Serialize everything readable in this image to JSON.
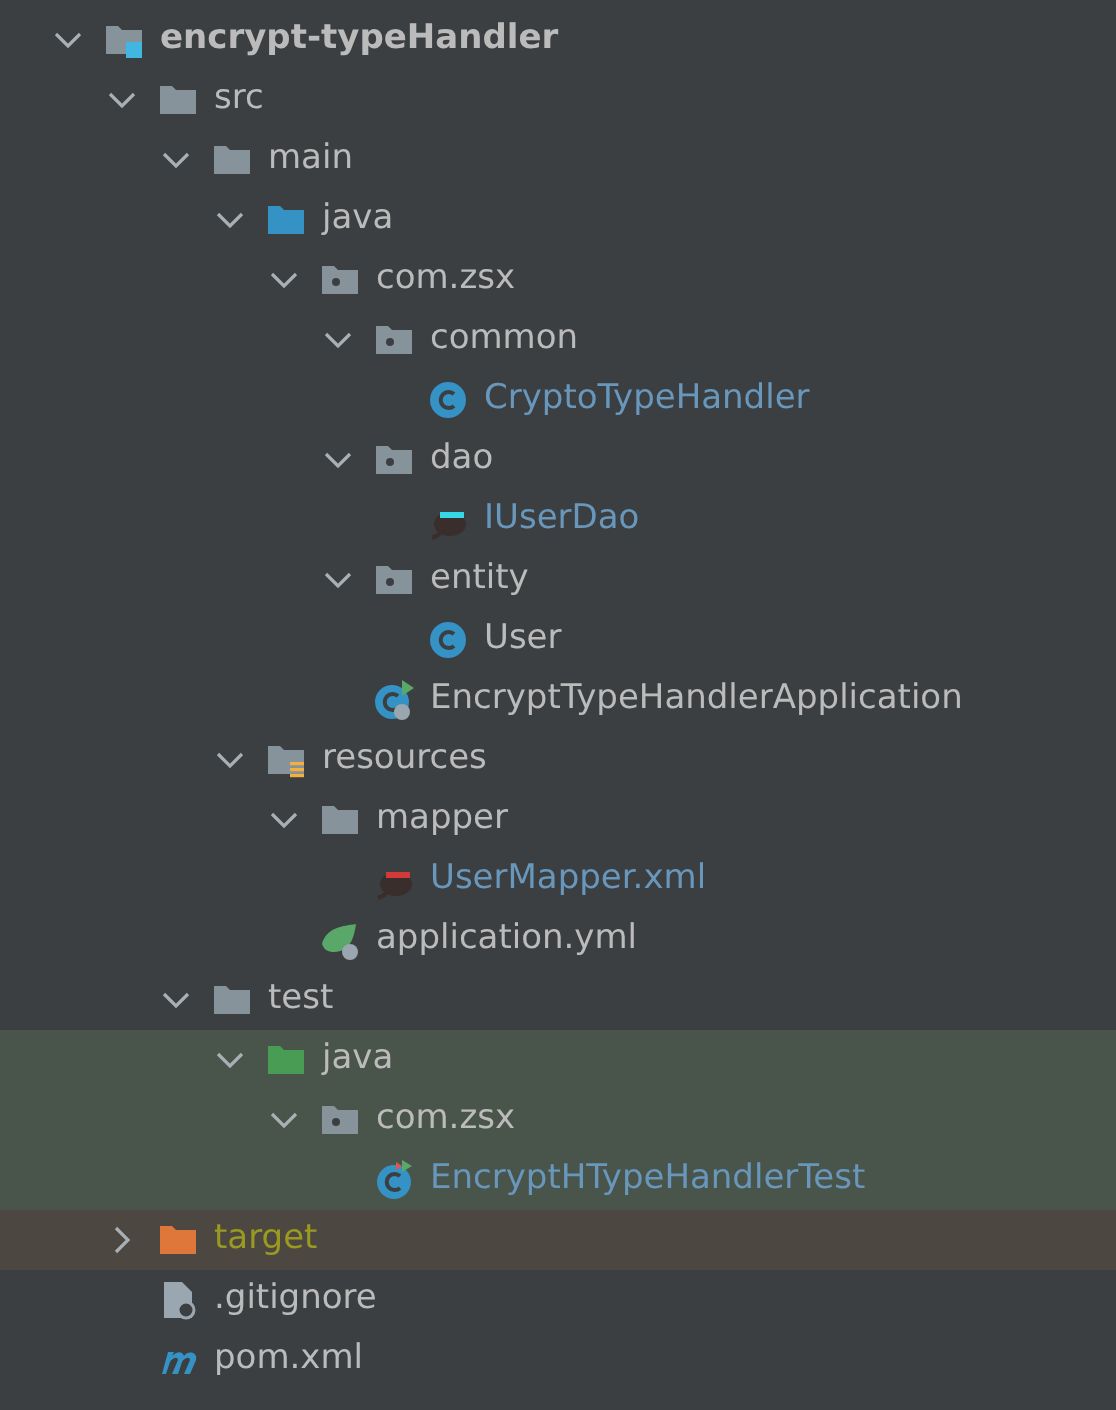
{
  "project_tree": [
    {
      "label": "encrypt-typeHandler",
      "kind": "module",
      "expanded": true,
      "modified": false,
      "ignored": false,
      "test": false,
      "excluded": false,
      "children": [
        {
          "label": "src",
          "kind": "folder",
          "expanded": true,
          "modified": false,
          "ignored": false,
          "test": false,
          "excluded": false,
          "children": [
            {
              "label": "main",
              "kind": "folder",
              "expanded": true,
              "modified": false,
              "ignored": false,
              "test": false,
              "excluded": false,
              "children": [
                {
                  "label": "java",
                  "kind": "source",
                  "expanded": true,
                  "modified": false,
                  "ignored": false,
                  "test": false,
                  "excluded": false,
                  "children": [
                    {
                      "label": "com.zsx",
                      "kind": "package",
                      "expanded": true,
                      "modified": false,
                      "ignored": false,
                      "test": false,
                      "excluded": false,
                      "children": [
                        {
                          "label": "common",
                          "kind": "package",
                          "expanded": true,
                          "modified": false,
                          "ignored": false,
                          "test": false,
                          "excluded": false,
                          "children": [
                            {
                              "label": "CryptoTypeHandler",
                              "kind": "class",
                              "modified": true,
                              "ignored": false,
                              "test": false,
                              "excluded": false
                            }
                          ]
                        },
                        {
                          "label": "dao",
                          "kind": "package",
                          "expanded": true,
                          "modified": false,
                          "ignored": false,
                          "test": false,
                          "excluded": false,
                          "children": [
                            {
                              "label": "IUserDao",
                              "kind": "mapper",
                              "modified": true,
                              "ignored": false,
                              "test": false,
                              "excluded": false
                            }
                          ]
                        },
                        {
                          "label": "entity",
                          "kind": "package",
                          "expanded": true,
                          "modified": false,
                          "ignored": false,
                          "test": false,
                          "excluded": false,
                          "children": [
                            {
                              "label": "User",
                              "kind": "class",
                              "modified": false,
                              "ignored": false,
                              "test": false,
                              "excluded": false
                            }
                          ]
                        },
                        {
                          "label": "EncryptTypeHandlerApplication",
                          "kind": "spring-class",
                          "modified": false,
                          "ignored": false,
                          "test": false,
                          "excluded": false
                        }
                      ]
                    }
                  ]
                },
                {
                  "label": "resources",
                  "kind": "resources",
                  "expanded": true,
                  "modified": false,
                  "ignored": false,
                  "test": false,
                  "excluded": false,
                  "children": [
                    {
                      "label": "mapper",
                      "kind": "folder",
                      "expanded": true,
                      "modified": false,
                      "ignored": false,
                      "test": false,
                      "excluded": false,
                      "children": [
                        {
                          "label": "UserMapper.xml",
                          "kind": "mapper-xml",
                          "modified": true,
                          "ignored": false,
                          "test": false,
                          "excluded": false
                        }
                      ]
                    },
                    {
                      "label": "application.yml",
                      "kind": "spring-yml",
                      "modified": false,
                      "ignored": false,
                      "test": false,
                      "excluded": false
                    }
                  ]
                }
              ]
            },
            {
              "label": "test",
              "kind": "folder",
              "expanded": true,
              "modified": false,
              "ignored": false,
              "test": false,
              "excluded": false,
              "children": [
                {
                  "label": "java",
                  "kind": "test-source",
                  "expanded": true,
                  "modified": false,
                  "ignored": false,
                  "test": true,
                  "excluded": false,
                  "children": [
                    {
                      "label": "com.zsx",
                      "kind": "package",
                      "expanded": true,
                      "modified": false,
                      "ignored": false,
                      "test": true,
                      "excluded": false,
                      "children": [
                        {
                          "label": "EncryptHTypeHandlerTest",
                          "kind": "test-class",
                          "modified": true,
                          "ignored": false,
                          "test": true,
                          "excluded": false
                        }
                      ]
                    }
                  ]
                }
              ]
            }
          ]
        },
        {
          "label": "target",
          "kind": "excluded",
          "expanded": false,
          "modified": false,
          "ignored": true,
          "test": false,
          "excluded": true
        },
        {
          "label": ".gitignore",
          "kind": "gitignore",
          "modified": false,
          "ignored": false,
          "test": false,
          "excluded": false
        },
        {
          "label": "pom.xml",
          "kind": "maven",
          "modified": false,
          "ignored": false,
          "test": false,
          "excluded": false
        }
      ]
    }
  ]
}
